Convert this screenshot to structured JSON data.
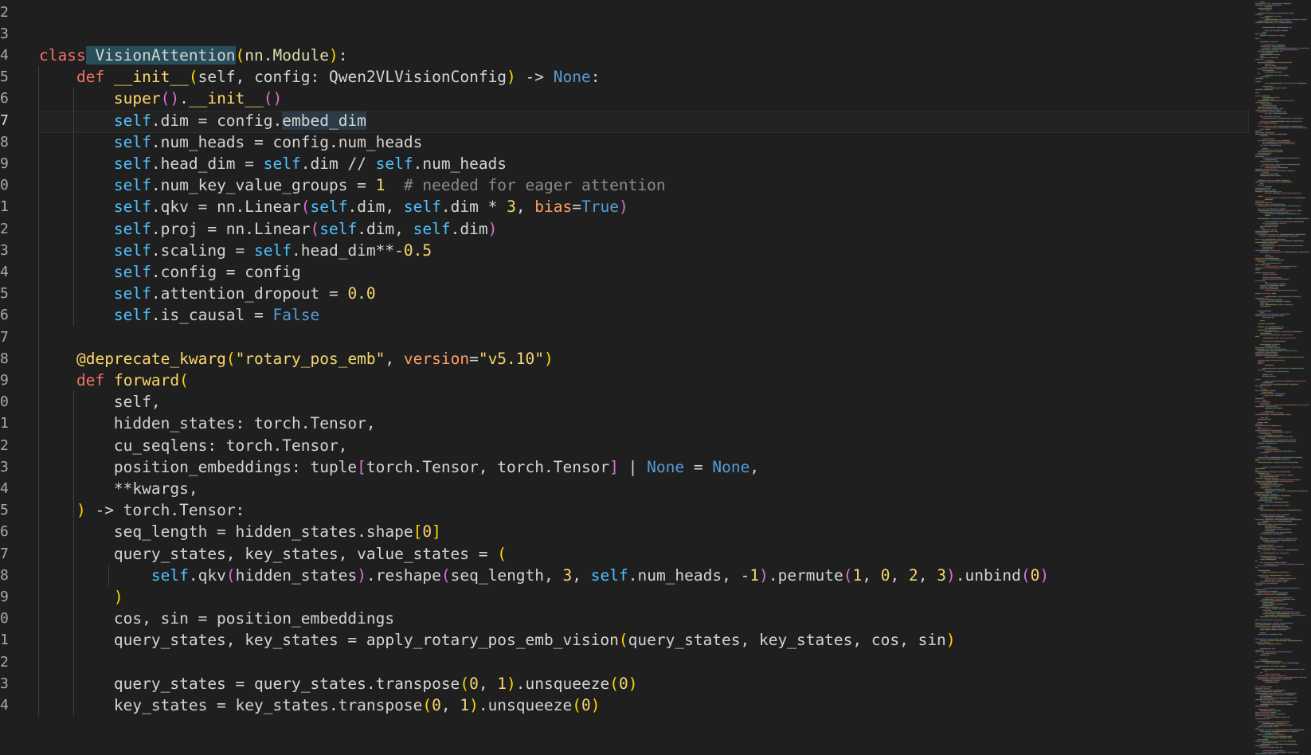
{
  "editor": {
    "language": "python",
    "current_line": 7,
    "colors": {
      "background": "#1f1f1f",
      "keyword": "#f47067",
      "builtin_constant": "#569cd6",
      "class_name": "#4ec9b0",
      "function_name": "#ffd866",
      "self": "#4fc1ff",
      "string": "#f5d76e",
      "comment": "#8a8a8a",
      "parameter_name": "#ff9e64"
    },
    "lines": [
      {
        "n": "2",
        "tokens": []
      },
      {
        "n": "3",
        "tokens": []
      },
      {
        "n": "4",
        "tokens": [
          [
            "t-kw-red",
            "class"
          ],
          [
            "sel",
            " VisionAttention"
          ],
          [
            "t-paren",
            "("
          ],
          [
            "t-base",
            "nn.Module"
          ],
          [
            "t-paren",
            ")"
          ],
          [
            "t-text",
            ":"
          ]
        ]
      },
      {
        "n": "5",
        "tokens": [
          [
            "t-text",
            "    "
          ],
          [
            "t-kw-red",
            "def"
          ],
          [
            "t-text",
            " "
          ],
          [
            "t-fn",
            "__init__"
          ],
          [
            "t-paren",
            "("
          ],
          [
            "t-text",
            "self, config: Qwen2VLVisionConfig"
          ],
          [
            "t-paren",
            ")"
          ],
          [
            "t-text",
            " -> "
          ],
          [
            "t-kw-blue",
            "None"
          ],
          [
            "t-text",
            ":"
          ]
        ]
      },
      {
        "n": "6",
        "tokens": [
          [
            "t-text",
            "        "
          ],
          [
            "t-fn",
            "super"
          ],
          [
            "t-paren2",
            "()"
          ],
          [
            "t-text",
            "."
          ],
          [
            "t-fn",
            "__init__"
          ],
          [
            "t-paren2",
            "()"
          ]
        ]
      },
      {
        "n": "7",
        "tokens": [
          [
            "t-text",
            "        "
          ],
          [
            "t-self",
            "self"
          ],
          [
            "t-text",
            ".dim = config."
          ],
          [
            "hl",
            "embed_dim"
          ]
        ]
      },
      {
        "n": "8",
        "tokens": [
          [
            "t-text",
            "        "
          ],
          [
            "t-self",
            "self"
          ],
          [
            "t-text",
            ".num_heads = config.num_heads"
          ]
        ]
      },
      {
        "n": "9",
        "tokens": [
          [
            "t-text",
            "        "
          ],
          [
            "t-self",
            "self"
          ],
          [
            "t-text",
            ".head_dim = "
          ],
          [
            "t-self",
            "self"
          ],
          [
            "t-text",
            ".dim // "
          ],
          [
            "t-self",
            "self"
          ],
          [
            "t-text",
            ".num_heads"
          ]
        ]
      },
      {
        "n": "0",
        "tokens": [
          [
            "t-text",
            "        "
          ],
          [
            "t-self",
            "self"
          ],
          [
            "t-text",
            ".num_key_value_groups = "
          ],
          [
            "t-num",
            "1"
          ],
          [
            "t-text",
            "  "
          ],
          [
            "t-comment",
            "# needed for eager attention"
          ]
        ]
      },
      {
        "n": "1",
        "tokens": [
          [
            "t-text",
            "        "
          ],
          [
            "t-self",
            "self"
          ],
          [
            "t-text",
            ".qkv = nn.Linear"
          ],
          [
            "t-paren2",
            "("
          ],
          [
            "t-self",
            "self"
          ],
          [
            "t-text",
            ".dim, "
          ],
          [
            "t-self",
            "self"
          ],
          [
            "t-text",
            ".dim * "
          ],
          [
            "t-num",
            "3"
          ],
          [
            "t-text",
            ", "
          ],
          [
            "t-param",
            "bias"
          ],
          [
            "t-text",
            "="
          ],
          [
            "t-kw-blue",
            "True"
          ],
          [
            "t-paren2",
            ")"
          ]
        ]
      },
      {
        "n": "2",
        "tokens": [
          [
            "t-text",
            "        "
          ],
          [
            "t-self",
            "self"
          ],
          [
            "t-text",
            ".proj = nn.Linear"
          ],
          [
            "t-paren2",
            "("
          ],
          [
            "t-self",
            "self"
          ],
          [
            "t-text",
            ".dim, "
          ],
          [
            "t-self",
            "self"
          ],
          [
            "t-text",
            ".dim"
          ],
          [
            "t-paren2",
            ")"
          ]
        ]
      },
      {
        "n": "3",
        "tokens": [
          [
            "t-text",
            "        "
          ],
          [
            "t-self",
            "self"
          ],
          [
            "t-text",
            ".scaling = "
          ],
          [
            "t-self",
            "self"
          ],
          [
            "t-text",
            ".head_dim**-"
          ],
          [
            "t-num",
            "0.5"
          ]
        ]
      },
      {
        "n": "4",
        "tokens": [
          [
            "t-text",
            "        "
          ],
          [
            "t-self",
            "self"
          ],
          [
            "t-text",
            ".config = config"
          ]
        ]
      },
      {
        "n": "5",
        "tokens": [
          [
            "t-text",
            "        "
          ],
          [
            "t-self",
            "self"
          ],
          [
            "t-text",
            ".attention_dropout = "
          ],
          [
            "t-num",
            "0.0"
          ]
        ]
      },
      {
        "n": "6",
        "tokens": [
          [
            "t-text",
            "        "
          ],
          [
            "t-self",
            "self"
          ],
          [
            "t-text",
            ".is_causal = "
          ],
          [
            "t-kw-blue",
            "False"
          ]
        ]
      },
      {
        "n": "7",
        "tokens": []
      },
      {
        "n": "8",
        "tokens": [
          [
            "t-text",
            "    "
          ],
          [
            "t-fn",
            "@deprecate_kwarg"
          ],
          [
            "t-paren",
            "("
          ],
          [
            "t-str",
            "\"rotary_pos_emb\""
          ],
          [
            "t-text",
            ", "
          ],
          [
            "t-param",
            "version"
          ],
          [
            "t-text",
            "="
          ],
          [
            "t-str",
            "\"v5.10\""
          ],
          [
            "t-paren",
            ")"
          ]
        ]
      },
      {
        "n": "9",
        "tokens": [
          [
            "t-text",
            "    "
          ],
          [
            "t-kw-red",
            "def"
          ],
          [
            "t-text",
            " "
          ],
          [
            "t-fn",
            "forward"
          ],
          [
            "t-paren",
            "("
          ]
        ]
      },
      {
        "n": "0",
        "tokens": [
          [
            "t-text",
            "        self,"
          ]
        ]
      },
      {
        "n": "1",
        "tokens": [
          [
            "t-text",
            "        hidden_states: torch.Tensor,"
          ]
        ]
      },
      {
        "n": "2",
        "tokens": [
          [
            "t-text",
            "        cu_seqlens: torch.Tensor,"
          ]
        ]
      },
      {
        "n": "3",
        "tokens": [
          [
            "t-text",
            "        position_embeddings: tuple"
          ],
          [
            "t-paren2",
            "["
          ],
          [
            "t-text",
            "torch.Tensor, torch.Tensor"
          ],
          [
            "t-paren2",
            "]"
          ],
          [
            "t-text",
            " | "
          ],
          [
            "t-kw-blue",
            "None"
          ],
          [
            "t-text",
            " = "
          ],
          [
            "t-kw-blue",
            "None"
          ],
          [
            "t-text",
            ","
          ]
        ]
      },
      {
        "n": "4",
        "tokens": [
          [
            "t-text",
            "        **kwargs,"
          ]
        ]
      },
      {
        "n": "5",
        "tokens": [
          [
            "t-text",
            "    "
          ],
          [
            "t-paren",
            ")"
          ],
          [
            "t-text",
            " -> torch.Tensor:"
          ]
        ]
      },
      {
        "n": "6",
        "tokens": [
          [
            "t-text",
            "        seq_length = hidden_states.shape"
          ],
          [
            "t-paren",
            "["
          ],
          [
            "t-num",
            "0"
          ],
          [
            "t-paren",
            "]"
          ]
        ]
      },
      {
        "n": "7",
        "tokens": [
          [
            "t-text",
            "        query_states, key_states, value_states = "
          ],
          [
            "t-paren",
            "("
          ]
        ]
      },
      {
        "n": "8",
        "tokens": [
          [
            "t-text",
            "            "
          ],
          [
            "t-self",
            "self"
          ],
          [
            "t-text",
            ".qkv"
          ],
          [
            "t-paren2",
            "("
          ],
          [
            "t-text",
            "hidden_states"
          ],
          [
            "t-paren2",
            ")"
          ],
          [
            "t-text",
            ".reshape"
          ],
          [
            "t-paren2",
            "("
          ],
          [
            "t-text",
            "seq_length, "
          ],
          [
            "t-num",
            "3"
          ],
          [
            "t-text",
            ", "
          ],
          [
            "t-self",
            "self"
          ],
          [
            "t-text",
            ".num_heads, -"
          ],
          [
            "t-num",
            "1"
          ],
          [
            "t-paren2",
            ")"
          ],
          [
            "t-text",
            ".permute"
          ],
          [
            "t-paren2",
            "("
          ],
          [
            "t-num",
            "1"
          ],
          [
            "t-text",
            ", "
          ],
          [
            "t-num",
            "0"
          ],
          [
            "t-text",
            ", "
          ],
          [
            "t-num",
            "2"
          ],
          [
            "t-text",
            ", "
          ],
          [
            "t-num",
            "3"
          ],
          [
            "t-paren2",
            ")"
          ],
          [
            "t-text",
            ".unbind"
          ],
          [
            "t-paren2",
            "("
          ],
          [
            "t-num",
            "0"
          ],
          [
            "t-paren2",
            ")"
          ]
        ]
      },
      {
        "n": "9",
        "tokens": [
          [
            "t-text",
            "        "
          ],
          [
            "t-paren",
            ")"
          ]
        ]
      },
      {
        "n": "0",
        "tokens": [
          [
            "t-text",
            "        cos, sin = position_embeddings"
          ]
        ]
      },
      {
        "n": "1",
        "tokens": [
          [
            "t-text",
            "        query_states, key_states = apply_rotary_pos_emb_vision"
          ],
          [
            "t-paren",
            "("
          ],
          [
            "t-text",
            "query_states, key_states, cos, sin"
          ],
          [
            "t-paren",
            ")"
          ]
        ]
      },
      {
        "n": "2",
        "tokens": []
      },
      {
        "n": "3",
        "tokens": [
          [
            "t-text",
            "        query_states = query_states.transpose"
          ],
          [
            "t-paren",
            "("
          ],
          [
            "t-num",
            "0"
          ],
          [
            "t-text",
            ", "
          ],
          [
            "t-num",
            "1"
          ],
          [
            "t-paren",
            ")"
          ],
          [
            "t-text",
            ".unsqueeze"
          ],
          [
            "t-paren",
            "("
          ],
          [
            "t-num",
            "0"
          ],
          [
            "t-paren",
            ")"
          ]
        ]
      },
      {
        "n": "4",
        "tokens": [
          [
            "t-text",
            "        key_states = key_states.transpose"
          ],
          [
            "t-paren",
            "("
          ],
          [
            "t-num",
            "0"
          ],
          [
            "t-text",
            ", "
          ],
          [
            "t-num",
            "1"
          ],
          [
            "t-paren",
            ")"
          ],
          [
            "t-text",
            ".unsqueeze"
          ],
          [
            "t-paren",
            "("
          ],
          [
            "t-num",
            "0"
          ],
          [
            "t-paren",
            ")"
          ]
        ]
      }
    ]
  }
}
